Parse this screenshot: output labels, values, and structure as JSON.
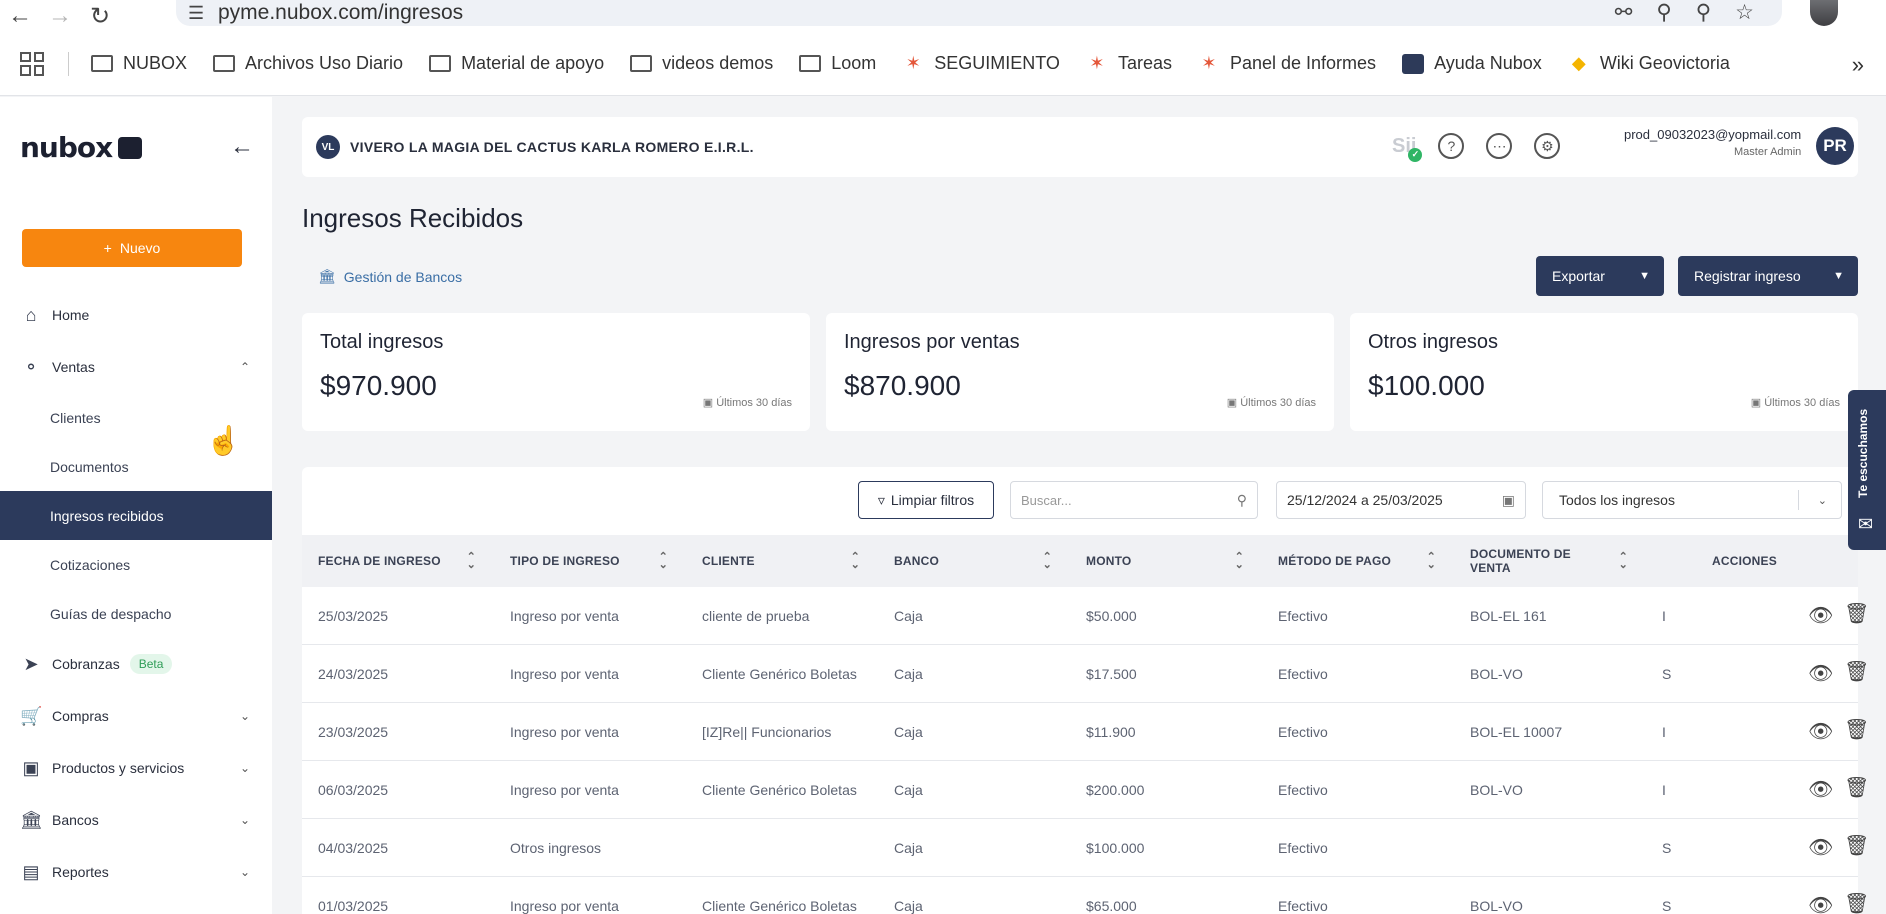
{
  "browser": {
    "url": "pyme.nubox.com/ingresos",
    "bookmarks": [
      {
        "label": "NUBOX",
        "icon": "folder-icon"
      },
      {
        "label": "Archivos Uso Diario",
        "icon": "folder-icon"
      },
      {
        "label": "Material de apoyo",
        "icon": "folder-icon"
      },
      {
        "label": "videos demos",
        "icon": "folder-icon"
      },
      {
        "label": "Loom",
        "icon": "folder-icon"
      },
      {
        "label": "SEGUIMIENTO",
        "icon": "hubspot-icon"
      },
      {
        "label": "Tareas",
        "icon": "hubspot-icon"
      },
      {
        "label": "Panel de Informes",
        "icon": "hubspot-icon"
      },
      {
        "label": "Ayuda Nubox",
        "icon": "nubox-icon"
      },
      {
        "label": "Wiki Geovictoria",
        "icon": "geovictoria-icon"
      }
    ]
  },
  "sidebar": {
    "logo": "nubox",
    "nuevo_label": "Nuevo",
    "items": [
      {
        "label": "Home"
      },
      {
        "label": "Ventas"
      },
      {
        "label": "Clientes"
      },
      {
        "label": "Documentos"
      },
      {
        "label": "Ingresos recibidos"
      },
      {
        "label": "Cotizaciones"
      },
      {
        "label": "Guías de despacho"
      },
      {
        "label": "Cobranzas",
        "badge": "Beta"
      },
      {
        "label": "Compras"
      },
      {
        "label": "Productos y servicios"
      },
      {
        "label": "Bancos"
      },
      {
        "label": "Reportes"
      }
    ]
  },
  "header": {
    "company_initials": "VL",
    "company_name": "VIVERO LA MAGIA DEL CACTUS KARLA ROMERO E.I.R.L.",
    "user_email": "prod_09032023@yopmail.com",
    "user_role": "Master Admin",
    "user_initials": "PR",
    "sii_label": "Sii"
  },
  "main": {
    "title": "Ingresos Recibidos",
    "gestion_label": "Gestión de Bancos",
    "exportar_label": "Exportar",
    "registrar_label": "Registrar ingreso",
    "cards": [
      {
        "title": "Total ingresos",
        "value": "$970.900",
        "period": "Últimos 30 días"
      },
      {
        "title": "Ingresos por ventas",
        "value": "$870.900",
        "period": "Últimos 30 días"
      },
      {
        "title": "Otros ingresos",
        "value": "$100.000",
        "period": "Últimos 30 días"
      }
    ],
    "filters": {
      "limpiar_label": "Limpiar filtros",
      "search_placeholder": "Buscar...",
      "date_range": "25/12/2024 a 25/03/2025",
      "tipo_select": "Todos los ingresos"
    },
    "columns": [
      "FECHA DE INGRESO",
      "TIPO DE INGRESO",
      "CLIENTE",
      "BANCO",
      "MONTO",
      "MÉTODO DE PAGO",
      "DOCUMENTO DE VENTA",
      "ACCIONES"
    ],
    "rows": [
      {
        "fecha": "25/03/2025",
        "tipo": "Ingreso por venta",
        "cliente": "cliente de prueba",
        "banco": "Caja",
        "monto": "$50.000",
        "metodo": "Efectivo",
        "documento": "BOL-EL 161",
        "extra": "I"
      },
      {
        "fecha": "24/03/2025",
        "tipo": "Ingreso por venta",
        "cliente": "Cliente Genérico Boletas",
        "banco": "Caja",
        "monto": "$17.500",
        "metodo": "Efectivo",
        "documento": "BOL-VO",
        "extra": "S"
      },
      {
        "fecha": "23/03/2025",
        "tipo": "Ingreso por venta",
        "cliente": "[IZ]Re|| Funcionarios",
        "banco": "Caja",
        "monto": "$11.900",
        "metodo": "Efectivo",
        "documento": "BOL-EL 10007",
        "extra": "I"
      },
      {
        "fecha": "06/03/2025",
        "tipo": "Ingreso por venta",
        "cliente": "Cliente Genérico Boletas",
        "banco": "Caja",
        "monto": "$200.000",
        "metodo": "Efectivo",
        "documento": "BOL-VO",
        "extra": "I"
      },
      {
        "fecha": "04/03/2025",
        "tipo": "Otros ingresos",
        "cliente": "",
        "banco": "Caja",
        "monto": "$100.000",
        "metodo": "Efectivo",
        "documento": "",
        "extra": "S"
      },
      {
        "fecha": "01/03/2025",
        "tipo": "Ingreso por venta",
        "cliente": "Cliente Genérico Boletas",
        "banco": "Caja",
        "monto": "$65.000",
        "metodo": "Efectivo",
        "documento": "BOL-VO",
        "extra": "S"
      }
    ]
  },
  "feedback_tab": "Te escuchamos",
  "colors": {
    "accent_orange": "#f7860f",
    "navy": "#2c3a5c",
    "link_blue": "#3a6ea5"
  }
}
